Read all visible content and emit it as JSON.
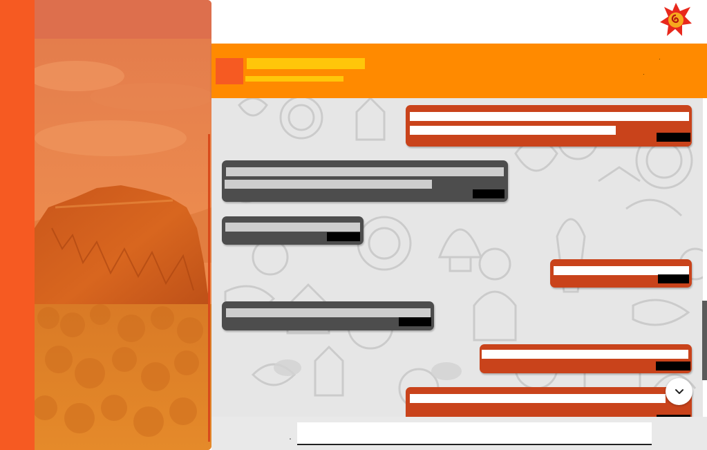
{
  "app": {
    "brand_logo": "sun-flower-logo-icon",
    "accent_color": "#f65a22",
    "header_color": "#ff8a00",
    "title_color": "#ffc60a"
  },
  "chat": {
    "avatar_icon": "chat-avatar-icon",
    "title": "",
    "subtitle": ""
  },
  "messages": [
    {
      "direction": "outgoing",
      "lines": [
        "",
        ""
      ],
      "time": ""
    },
    {
      "direction": "incoming",
      "lines": [
        "",
        ""
      ],
      "time": ""
    },
    {
      "direction": "incoming",
      "lines": [
        ""
      ],
      "time": ""
    },
    {
      "direction": "outgoing",
      "lines": [
        ""
      ],
      "time": ""
    },
    {
      "direction": "incoming",
      "lines": [
        ""
      ],
      "time": ""
    },
    {
      "direction": "outgoing",
      "lines": [
        ""
      ],
      "time": ""
    },
    {
      "direction": "outgoing",
      "lines": [
        ""
      ],
      "time": ""
    }
  ],
  "controls": {
    "scroll_down_icon": "chevron-down-icon"
  },
  "composer": {
    "value": "",
    "placeholder": ""
  }
}
